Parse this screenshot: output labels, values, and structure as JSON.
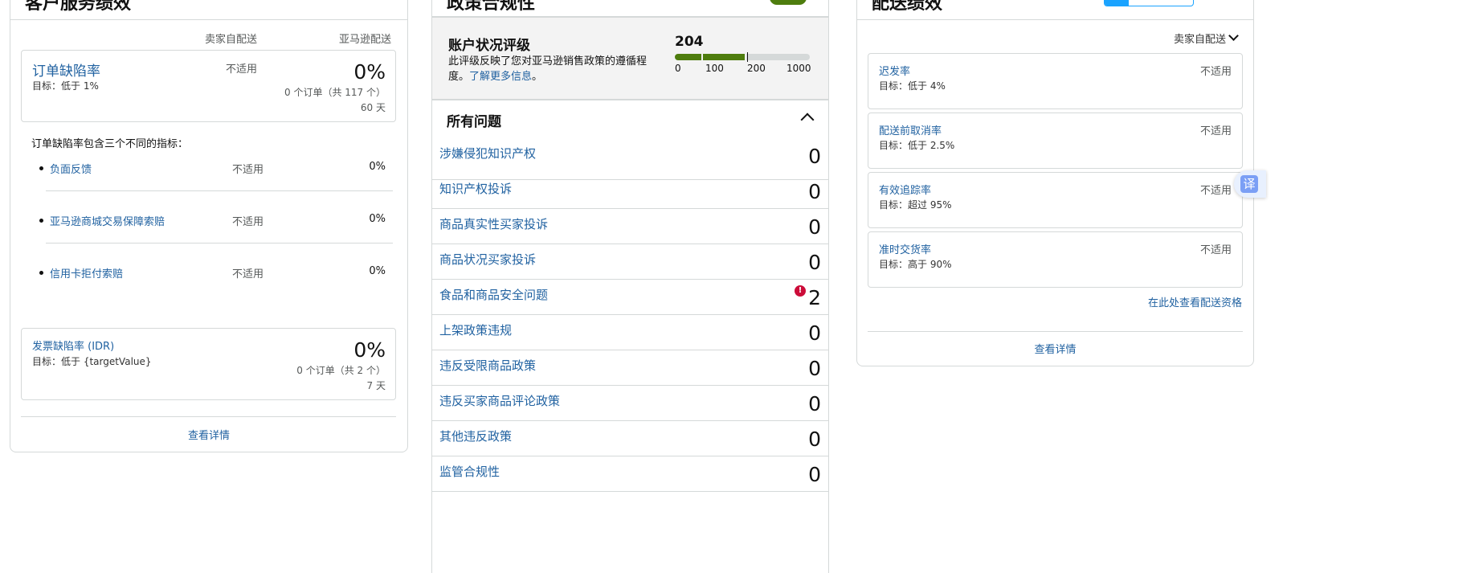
{
  "customer_service": {
    "title": "客户服务绩效",
    "col_seller": "卖家自配送",
    "col_amazon": "亚马逊配送",
    "odr": {
      "label": "订单缺陷率",
      "target": "目标：低于 1%",
      "seller_value": "不适用",
      "amazon_value": "0%",
      "orders": "0 个订单（共 117 个）",
      "period": "60 天"
    },
    "intro": "订单缺陷率包含三个不同的指标：",
    "metrics": [
      {
        "label": "负面反馈",
        "seller": "不适用",
        "amazon": "0%"
      },
      {
        "label": "亚马逊商城交易保障索赔",
        "seller": "不适用",
        "amazon": "0%"
      },
      {
        "label": "信用卡拒付索赔",
        "seller": "不适用",
        "amazon": "0%"
      }
    ],
    "idr": {
      "label": "发票缺陷率 (IDR)",
      "target": "目标：低于 {targetValue}",
      "value": "0%",
      "orders": "0 个订单（共 2 个）",
      "period": "7 天"
    },
    "details_link": "查看详情"
  },
  "policy": {
    "title": "政策合规性",
    "ahr": {
      "label": "账户状况评级",
      "desc_prefix": "此评级反映了您对亚马逊销售政策的遵循程度。",
      "learn_more": "了解更多信息",
      "desc_suffix": "。",
      "score": "204",
      "score_value": 204,
      "scale_max": 1000,
      "ticks": [
        "0",
        "100",
        "200",
        "1000"
      ]
    },
    "issues_title": "所有问题",
    "issues": [
      {
        "label": "涉嫌侵犯知识产权",
        "count": "0",
        "alert": false
      },
      {
        "label": "知识产权投诉",
        "count": "0",
        "alert": false
      },
      {
        "label": "商品真实性买家投诉",
        "count": "0",
        "alert": false
      },
      {
        "label": "商品状况买家投诉",
        "count": "0",
        "alert": false
      },
      {
        "label": "食品和商品安全问题",
        "count": "2",
        "alert": true
      },
      {
        "label": "上架政策违规",
        "count": "0",
        "alert": false
      },
      {
        "label": "违反受限商品政策",
        "count": "0",
        "alert": false
      },
      {
        "label": "违反买家商品评论政策",
        "count": "0",
        "alert": false
      },
      {
        "label": "其他违反政策",
        "count": "0",
        "alert": false
      },
      {
        "label": "监管合规性",
        "count": "0",
        "alert": false
      }
    ],
    "alert_icon": "!"
  },
  "shipping": {
    "title": "配送绩效",
    "dropdown": "卖家自配送",
    "metrics": [
      {
        "label": "迟发率",
        "target": "目标：低于 4%",
        "value": "不适用"
      },
      {
        "label": "配送前取消率",
        "target": "目标：低于 2.5%",
        "value": "不适用"
      },
      {
        "label": "有效追踪率",
        "target": "目标：超过 95%",
        "value": "不适用"
      },
      {
        "label": "准时交货率",
        "target": "目标：高于 90%",
        "value": "不适用"
      }
    ],
    "eligibility_link": "在此处查看配送资格",
    "details_link": "查看详情"
  },
  "translate_button": "译",
  "colors": {
    "link": "#2162a1",
    "green": "#4e7d0e",
    "alert_red": "#cc0c39",
    "border": "#d5d9d9",
    "bar_grey": "#d5d9d9",
    "toggle_blue": "#1aa3ff"
  }
}
